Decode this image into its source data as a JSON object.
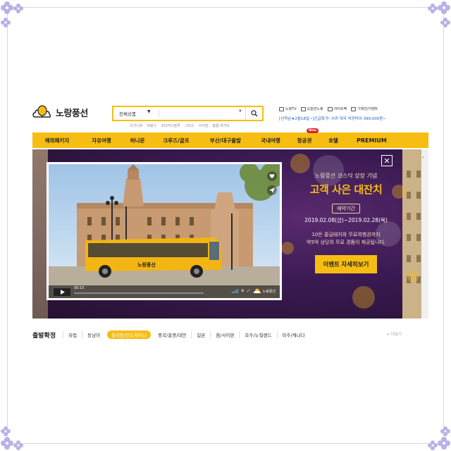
{
  "header": {
    "logo_text": "노랑풍선",
    "search": {
      "category": "전체상품",
      "placeholder": ""
    },
    "keywords": [
      "오키나와",
      "프랑스",
      "코타키나발루",
      "그리스",
      "사이판",
      "홍콩 마카오"
    ],
    "util_links": [
      "노랑TV",
      "오늘만노랑",
      "라이트팩",
      "기획전/이벤트"
    ],
    "ticker": "[선착순★2월18일~]긴급특가! 서귀 대국 치앙마이 399,000원~"
  },
  "nav": {
    "items": [
      "해외패키지",
      "자유여행",
      "허니문",
      "크루즈/골프",
      "부산/대구출발",
      "국내여행",
      "항공권",
      "호텔",
      "PREMIUM"
    ],
    "new_badge": "New"
  },
  "banner": {
    "video": {
      "time": "00:15",
      "bus_text": "노랑풍선",
      "watermark": "노랑풍선"
    },
    "promo": {
      "subtitle": "노랑풍선 코스닥 상장 기념",
      "title": "고객 사은 대잔치",
      "period_label": "예약기간",
      "period": "2019.02.08(금)~2019.02.28(목)",
      "desc_line1": "10돈 황금돼지와 무료여행권까지",
      "desc_line2": "약5억 상당의 무료 경품이 제공됩니다.",
      "cta": "이벤트 자세히보기"
    },
    "close_symbol": "✕"
  },
  "departures": {
    "title": "출발확정",
    "items": [
      "유럽",
      "동남아",
      "필리핀/인도차이나",
      "중국/홍콩/대만",
      "일본",
      "괌/사이판",
      "호주/뉴질랜드",
      "미주/캐나다"
    ],
    "active_index": 2,
    "more": "더보기"
  },
  "colors": {
    "brand_yellow": "#f6bd13",
    "banner_purple": "#3a1a52",
    "ticker_blue": "#1f5fb5"
  }
}
